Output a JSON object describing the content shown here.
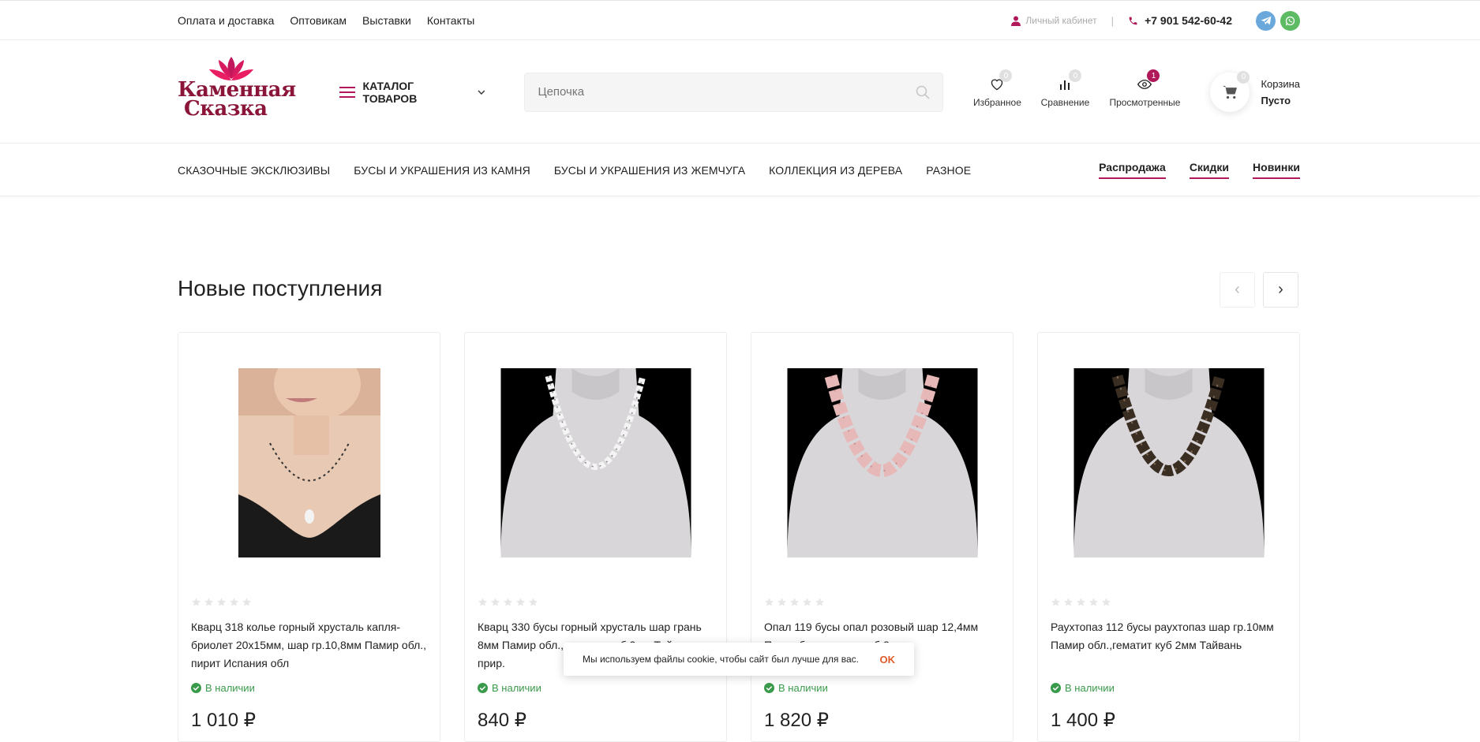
{
  "topbar": {
    "links": [
      "Оплата и доставка",
      "Оптовикам",
      "Выставки",
      "Контакты"
    ],
    "cabinet": "Личный кабинет",
    "separator": "|",
    "phone": "+7 901 542-60-42"
  },
  "header": {
    "logo": {
      "line1": "Каменная",
      "line2": "Сказка"
    },
    "catalog_label": "КАТАЛОГ ТОВАРОВ",
    "search_placeholder": "Цепочка",
    "icons": [
      {
        "label": "Избранное",
        "count": "0"
      },
      {
        "label": "Сравнение",
        "count": "0"
      },
      {
        "label": "Просмотренные",
        "count": "1"
      }
    ],
    "cart": {
      "label": "Корзина",
      "status": "Пусто",
      "count": "0"
    }
  },
  "nav": {
    "items": [
      "СКАЗОЧНЫЕ ЭКСКЛЮЗИВЫ",
      "БУСЫ И УКРАШЕНИЯ ИЗ КАМНЯ",
      "БУСЫ И УКРАШЕНИЯ ИЗ ЖЕМЧУГА",
      "КОЛЛЕКЦИЯ ИЗ ДЕРЕВА",
      "РАЗНОЕ"
    ],
    "promo": [
      "Распродажа",
      "Скидки",
      "Новинки"
    ]
  },
  "section": {
    "title": "Новые поступления",
    "prev": "‹",
    "next": "›"
  },
  "products": [
    {
      "name": "Кварц 318 колье горный хрусталь капля-бриолет 20х15мм, шар гр.10,8мм Памир обл., пирит Испания обл",
      "stock": "В наличии",
      "price": "1 010 ₽"
    },
    {
      "name": "Кварц 330 бусы горный хрусталь шар грань 8мм Памир обл., гематит куб 2мм Тайвань, прир.",
      "stock": "В наличии",
      "price": "840 ₽"
    },
    {
      "name": "Опал 119 бусы опал розовый шар 12,4мм Перу обл., гематит куб 2мм",
      "stock": "В наличии",
      "price": "1 820 ₽"
    },
    {
      "name": "Раухтопаз 112 бусы раухтопаз шар гр.10мм Памир обл.,гематит куб 2мм Тайвань",
      "stock": "В наличии",
      "price": "1 400 ₽"
    }
  ],
  "cookie": {
    "text": "Мы используем файлы cookie, чтобы сайт был лучше для вас.",
    "ok": "OK"
  },
  "colors": {
    "accent": "#b0185a",
    "logo": "#8a1538",
    "stock_green": "#3a9a4b",
    "telegram": "#6aa8dc",
    "whatsapp": "#5dbb63"
  }
}
